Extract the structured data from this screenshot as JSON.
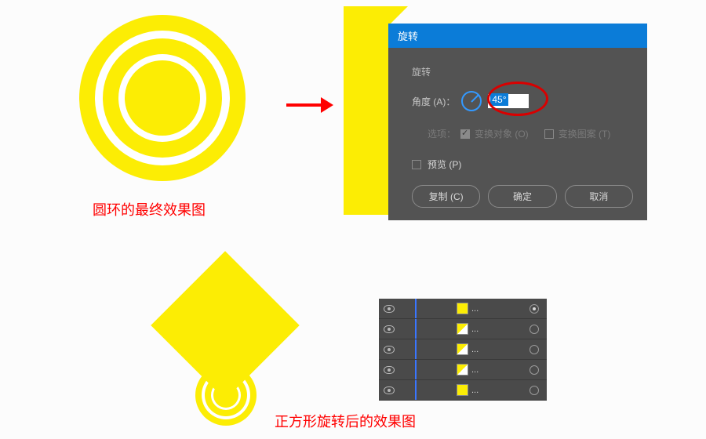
{
  "rings_caption": "圆环的最终效果图",
  "diamond_caption": "正方形旋转后的效果图",
  "dialog": {
    "title": "旋转",
    "group_label": "旋转",
    "angle_label": "角度 (A)：",
    "angle_value": "45°",
    "options_label": "选项：",
    "opt_object": "变换对象 (O)",
    "opt_pattern": "变换图案 (T)",
    "preview_label": "预览 (P)",
    "btn_copy": "复制 (C)",
    "btn_ok": "确定",
    "btn_cancel": "取消"
  },
  "layers": {
    "item_label": "...",
    "items": [
      {
        "thumb": "a"
      },
      {
        "thumb": "b"
      },
      {
        "thumb": "b"
      },
      {
        "thumb": "b"
      },
      {
        "thumb": "a"
      }
    ]
  },
  "colors": {
    "yellow": "#fced04",
    "red": "#ff0000",
    "blue": "#0b7cd8"
  }
}
